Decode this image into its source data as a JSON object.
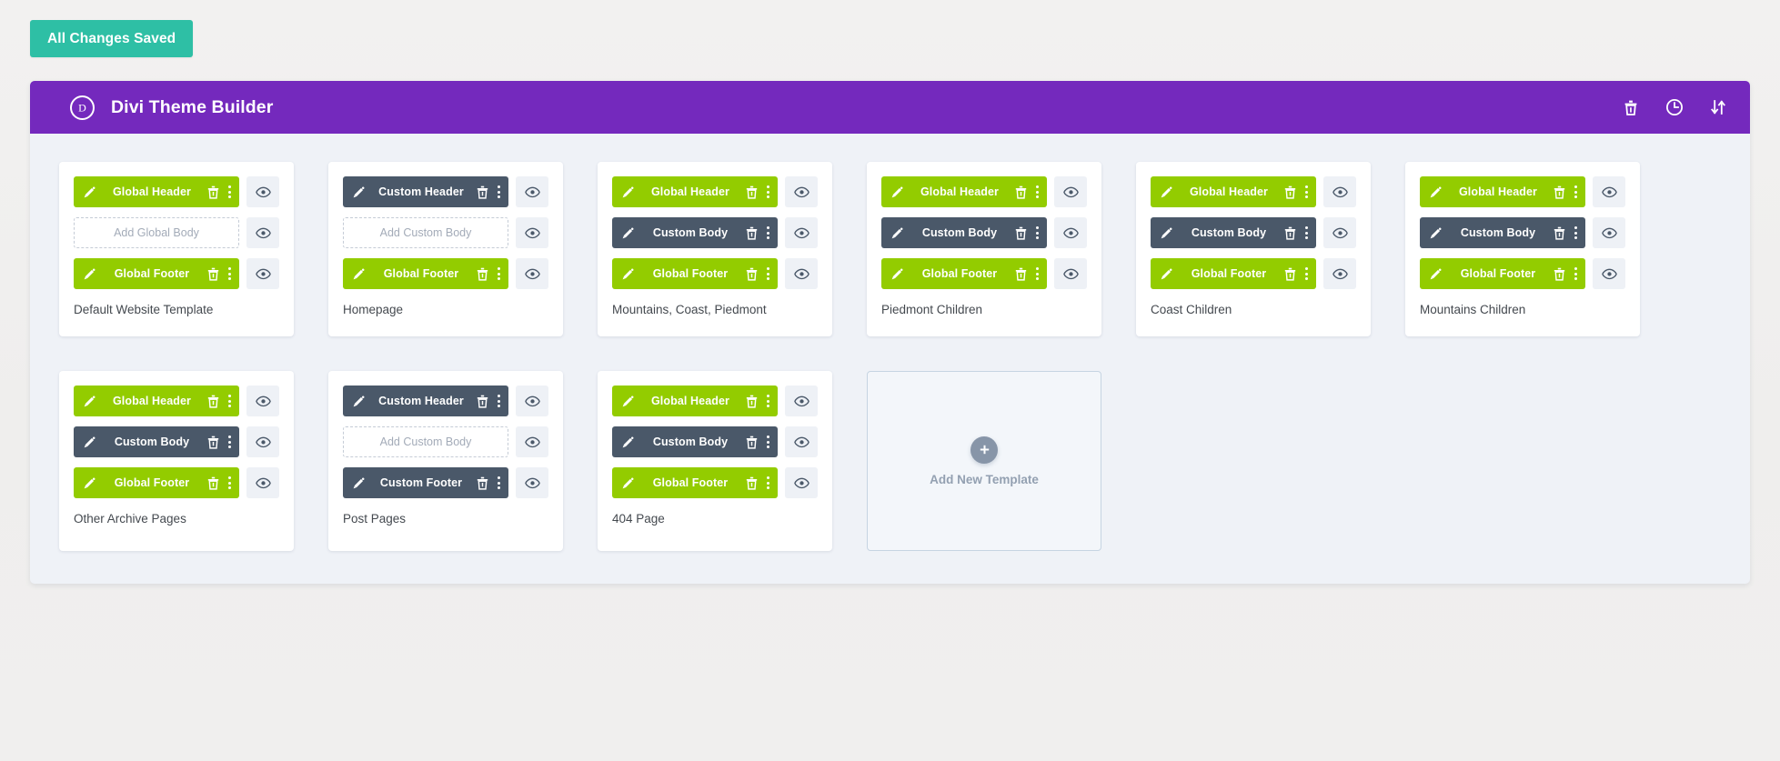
{
  "save_notice": {
    "label": "All Changes Saved"
  },
  "header": {
    "title": "Divi Theme Builder",
    "logo_letter": "D",
    "actions": [
      {
        "name": "trash-icon",
        "tooltip": "Delete"
      },
      {
        "name": "clock-icon",
        "tooltip": "History"
      },
      {
        "name": "portability-icon",
        "tooltip": "Portability"
      }
    ]
  },
  "colors": {
    "accent_purple": "#7429bd",
    "saved_teal": "#2ebfa5",
    "global_green": "#93cc00",
    "custom_dark": "#4a5869",
    "panel_bg": "#eff2f7",
    "page_bg": "#f1f0ef",
    "eye_btn_bg": "#eef1f6",
    "dashed_border": "#c5ccd6"
  },
  "add_template": {
    "label": "Add New Template",
    "icon": "plus-icon"
  },
  "templates": [
    {
      "title": "Default Website Template",
      "rows": [
        {
          "label": "Global Header",
          "state": "assigned",
          "style": "green"
        },
        {
          "label": "Add Global Body",
          "state": "empty",
          "style": "dashed"
        },
        {
          "label": "Global Footer",
          "state": "assigned",
          "style": "green"
        }
      ]
    },
    {
      "title": "Homepage",
      "rows": [
        {
          "label": "Custom Header",
          "state": "assigned",
          "style": "dark"
        },
        {
          "label": "Add Custom Body",
          "state": "empty",
          "style": "dashed"
        },
        {
          "label": "Global Footer",
          "state": "assigned",
          "style": "green"
        }
      ]
    },
    {
      "title": "Mountains, Coast, Piedmont",
      "rows": [
        {
          "label": "Global Header",
          "state": "assigned",
          "style": "green"
        },
        {
          "label": "Custom Body",
          "state": "assigned",
          "style": "dark"
        },
        {
          "label": "Global Footer",
          "state": "assigned",
          "style": "green"
        }
      ]
    },
    {
      "title": "Piedmont Children",
      "rows": [
        {
          "label": "Global Header",
          "state": "assigned",
          "style": "green"
        },
        {
          "label": "Custom Body",
          "state": "assigned",
          "style": "dark"
        },
        {
          "label": "Global Footer",
          "state": "assigned",
          "style": "green"
        }
      ]
    },
    {
      "title": "Coast Children",
      "rows": [
        {
          "label": "Global Header",
          "state": "assigned",
          "style": "green"
        },
        {
          "label": "Custom Body",
          "state": "assigned",
          "style": "dark"
        },
        {
          "label": "Global Footer",
          "state": "assigned",
          "style": "green"
        }
      ]
    },
    {
      "title": "Mountains Children",
      "rows": [
        {
          "label": "Global Header",
          "state": "assigned",
          "style": "green"
        },
        {
          "label": "Custom Body",
          "state": "assigned",
          "style": "dark"
        },
        {
          "label": "Global Footer",
          "state": "assigned",
          "style": "green"
        }
      ]
    },
    {
      "title": "Other Archive Pages",
      "rows": [
        {
          "label": "Global Header",
          "state": "assigned",
          "style": "green"
        },
        {
          "label": "Custom Body",
          "state": "assigned",
          "style": "dark"
        },
        {
          "label": "Global Footer",
          "state": "assigned",
          "style": "green"
        }
      ]
    },
    {
      "title": "Post Pages",
      "rows": [
        {
          "label": "Custom Header",
          "state": "assigned",
          "style": "dark"
        },
        {
          "label": "Add Custom Body",
          "state": "empty",
          "style": "dashed"
        },
        {
          "label": "Custom Footer",
          "state": "assigned",
          "style": "dark"
        }
      ]
    },
    {
      "title": "404 Page",
      "rows": [
        {
          "label": "Global Header",
          "state": "assigned",
          "style": "green"
        },
        {
          "label": "Custom Body",
          "state": "assigned",
          "style": "dark"
        },
        {
          "label": "Global Footer",
          "state": "assigned",
          "style": "green"
        }
      ]
    }
  ]
}
